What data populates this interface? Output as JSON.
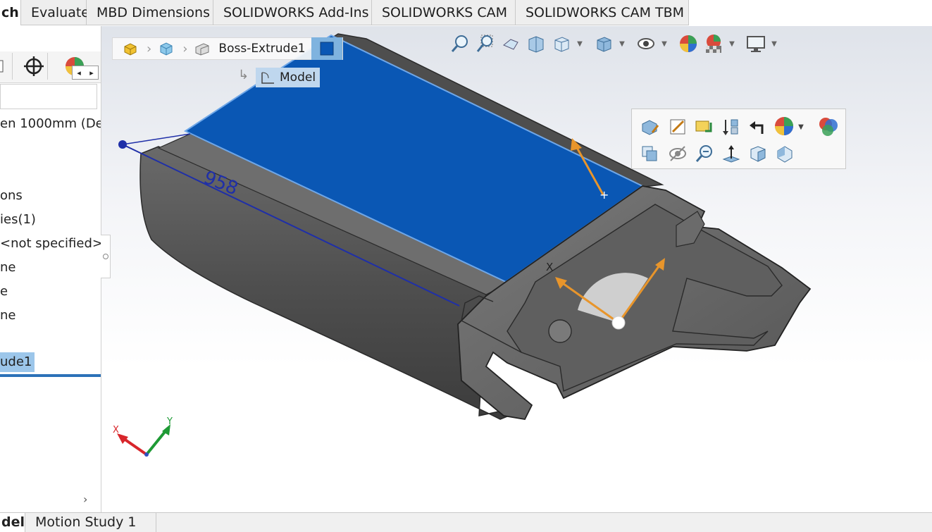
{
  "top_tabs": [
    {
      "label": "ch",
      "active": true
    },
    {
      "label": "Evaluate"
    },
    {
      "label": "MBD Dimensions"
    },
    {
      "label": "SOLIDWORKS Add-Ins"
    },
    {
      "label": "SOLIDWORKS CAM"
    },
    {
      "label": "SOLIDWORKS CAM TBM"
    }
  ],
  "feature_manager": {
    "toolbar_icons": [
      "feature-tree-icon",
      "property-manager-icon",
      "configuration-manager-icon",
      "display-manager-icon"
    ],
    "part_name": "en 1000mm  (De",
    "items": [
      "ons",
      "ies(1)",
      "<not specified>",
      "ne",
      "e",
      "ne",
      "ude1"
    ],
    "scroll_arrow": "›"
  },
  "breadcrumb": {
    "feature": "Boss-Extrude1",
    "body": "Model"
  },
  "dimension_value": "958",
  "axis_label": "X",
  "triad": {
    "x": "X",
    "y": "Y"
  },
  "bottom_tabs": [
    {
      "label": "del",
      "active": true
    },
    {
      "label": "Motion Study 1"
    }
  ],
  "colors": {
    "selected_face": "#0a57b4",
    "model_body": "#5d5d5d",
    "arrow": "#e8952b",
    "dimension": "#1f2fa8",
    "tree_selected": "#9cc6ea"
  }
}
